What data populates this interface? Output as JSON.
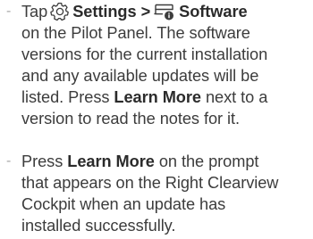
{
  "instructions": {
    "item1": {
      "dash": "-",
      "tap": "Tap",
      "settings_label": "Settings",
      "separator": ">",
      "software_label": "Software",
      "line2": "on the Pilot Panel. The software",
      "line3": "versions for the current installation",
      "line4": "and any available updates will be",
      "line5_pre": "listed. Press",
      "learn_more": "Learn More",
      "line5_post": "next to a",
      "line6": "version to read the notes for it.",
      "icons": [
        "gear-icon",
        "software-icon"
      ]
    },
    "item2": {
      "dash": "-",
      "press": "Press",
      "learn_more": "Learn More",
      "line1_post": "on the prompt",
      "line2": "that appears on the Right Clearview",
      "line3": "Cockpit when an update has",
      "line4": "installed successfully."
    }
  }
}
